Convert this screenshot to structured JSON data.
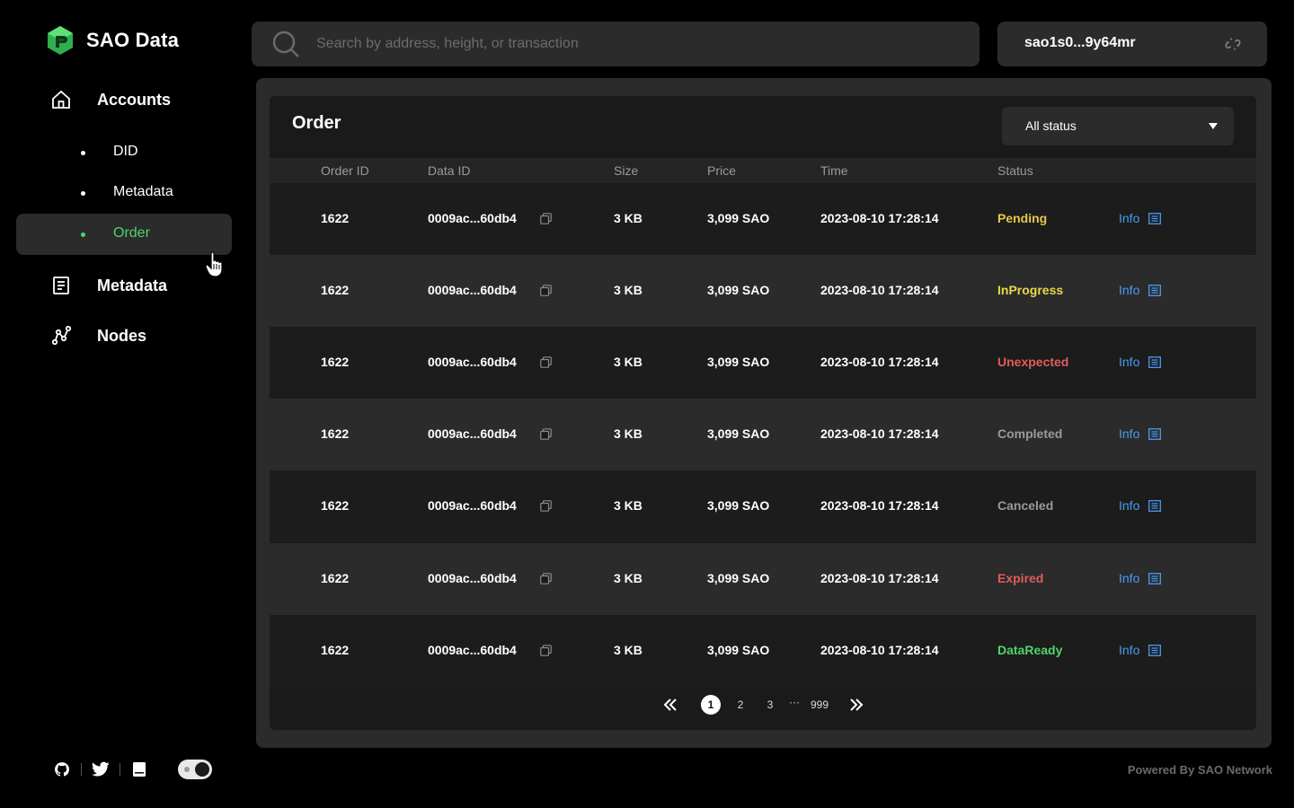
{
  "app": {
    "name": "SAO Data",
    "colors": {
      "accent": "#4fd46b",
      "link": "#4a9bf0"
    }
  },
  "sidebar": {
    "accounts": {
      "label": "Accounts",
      "icon": "home-icon"
    },
    "sub_items": [
      {
        "label": "DID",
        "active": false
      },
      {
        "label": "Metadata",
        "active": false
      },
      {
        "label": "Order",
        "active": true
      }
    ],
    "metadata": {
      "label": "Metadata",
      "icon": "document-icon"
    },
    "nodes": {
      "label": "Nodes",
      "icon": "nodes-icon"
    },
    "footer_icons": [
      "github-icon",
      "twitter-icon",
      "book-icon",
      "theme-toggle"
    ]
  },
  "search": {
    "placeholder": "Search by address, height, or transaction",
    "value": ""
  },
  "wallet": {
    "address": "sao1s0...9y64mr",
    "icon": "unlink-icon"
  },
  "order": {
    "title": "Order",
    "status_filter": "All status",
    "columns": [
      "Order ID",
      "Data ID",
      "Size",
      "Price",
      "Time",
      "Status"
    ],
    "rows": [
      {
        "order_id": "1622",
        "data_id": "0009ac...60db4",
        "size": "3 KB",
        "price": "3,099 SAO",
        "time": "2023-08-10 17:28:14",
        "status": "Pending",
        "status_color": "#e6c84a",
        "info": "Info"
      },
      {
        "order_id": "1622",
        "data_id": "0009ac...60db4",
        "size": "3 KB",
        "price": "3,099 SAO",
        "time": "2023-08-10 17:28:14",
        "status": "InProgress",
        "status_color": "#e6d84a",
        "info": "Info"
      },
      {
        "order_id": "1622",
        "data_id": "0009ac...60db4",
        "size": "3 KB",
        "price": "3,099 SAO",
        "time": "2023-08-10 17:28:14",
        "status": "Unexpected",
        "status_color": "#e25b5b",
        "info": "Info"
      },
      {
        "order_id": "1622",
        "data_id": "0009ac...60db4",
        "size": "3 KB",
        "price": "3,099 SAO",
        "time": "2023-08-10 17:28:14",
        "status": "Completed",
        "status_color": "#9a9a9a",
        "info": "Info"
      },
      {
        "order_id": "1622",
        "data_id": "0009ac...60db4",
        "size": "3 KB",
        "price": "3,099 SAO",
        "time": "2023-08-10 17:28:14",
        "status": "Canceled",
        "status_color": "#9a9a9a",
        "info": "Info"
      },
      {
        "order_id": "1622",
        "data_id": "0009ac...60db4",
        "size": "3 KB",
        "price": "3,099 SAO",
        "time": "2023-08-10 17:28:14",
        "status": "Expired",
        "status_color": "#e25b5b",
        "info": "Info"
      },
      {
        "order_id": "1622",
        "data_id": "0009ac...60db4",
        "size": "3 KB",
        "price": "3,099 SAO",
        "time": "2023-08-10 17:28:14",
        "status": "DataReady",
        "status_color": "#4fd46b",
        "info": "Info"
      }
    ],
    "pagination": {
      "pages": [
        "1",
        "2",
        "3",
        "···",
        "999"
      ],
      "current": "1"
    }
  },
  "footer": {
    "powered_by": "Powered By SAO Network"
  }
}
